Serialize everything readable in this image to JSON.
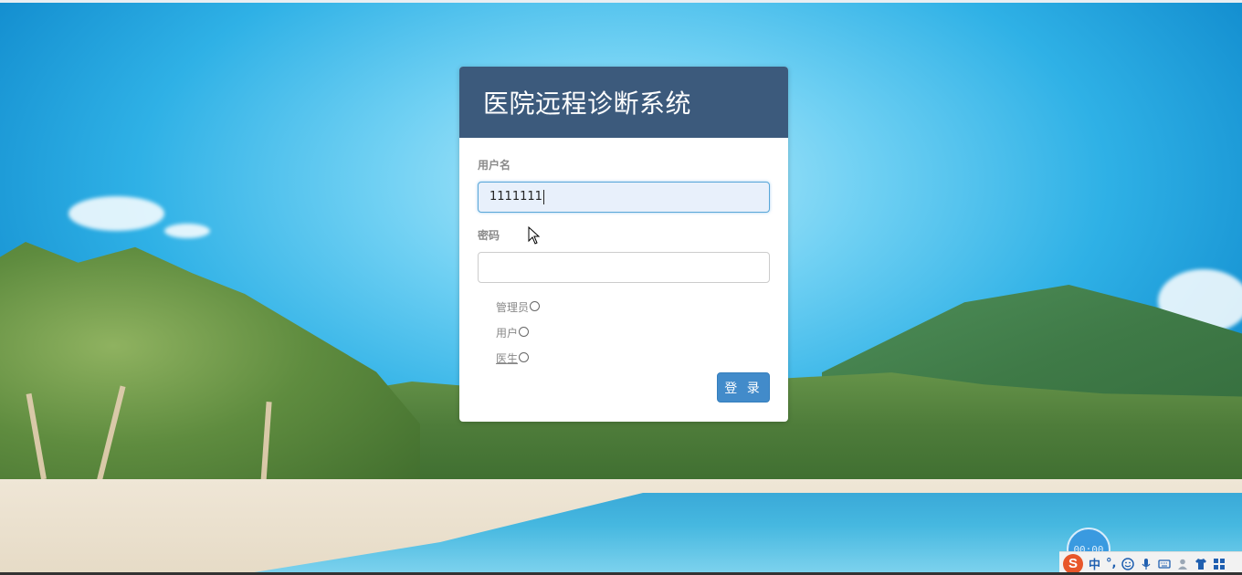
{
  "login": {
    "title": "医院远程诊断系统",
    "username_label": "用户名",
    "username_value": "1111111",
    "password_label": "密码",
    "password_value": "",
    "roles": [
      {
        "label": "管理员",
        "selected": false
      },
      {
        "label": "用户",
        "selected": false
      },
      {
        "label": "医生",
        "selected": false
      }
    ],
    "submit_label": "登 录"
  },
  "taskbar": {
    "timer": "00:00",
    "ime_logo": "S",
    "ime_mode": "中",
    "ime_punct": "°,",
    "icons": [
      "smiley-icon",
      "microphone-icon",
      "keyboard-icon",
      "user-icon",
      "shirt-icon",
      "grid-icon"
    ]
  },
  "colors": {
    "header": "#3c5a7c",
    "button": "#428bca",
    "input_focus_bg": "#e8f0fb",
    "ime_logo": "#e8562a",
    "ime_text": "#1f5fb0"
  }
}
